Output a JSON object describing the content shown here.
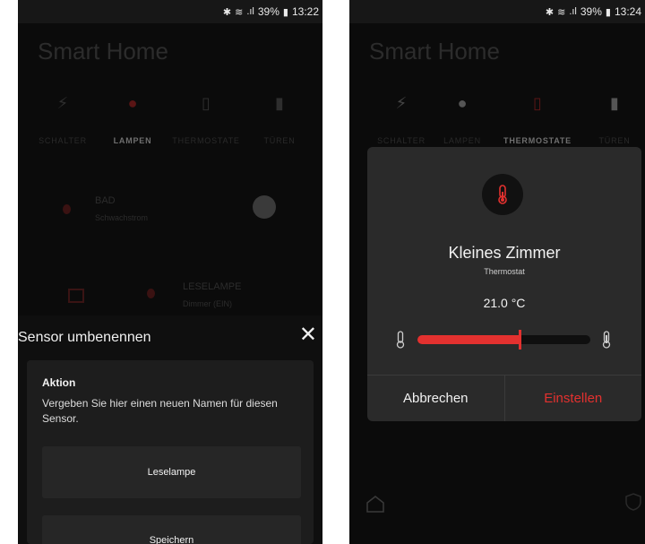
{
  "left": {
    "status": {
      "bluetooth": "✱",
      "wifi": "≋",
      "signal": ".ıl",
      "battery_pct": "39%",
      "battery": "▮",
      "time": "13:22"
    },
    "app_title": "Smart Home",
    "tabs": [
      {
        "label": "SCHALTER",
        "icon": "bolt-icon"
      },
      {
        "label": "LAMPEN",
        "icon": "bulb-icon"
      },
      {
        "label": "THERMOSTATE",
        "icon": "thermometer-icon"
      },
      {
        "label": "TÜREN",
        "icon": "door-icon"
      }
    ],
    "bg_items": [
      {
        "name": "BAD",
        "type": "Schwachstrom"
      },
      {
        "name": "LESELAMPE",
        "type": "Dimmer (EIN)"
      }
    ],
    "sheet": {
      "title": "Sensor umbenennen",
      "close": "✕",
      "heading": "Aktion",
      "description": "Vergeben Sie hier einen neuen Namen für diesen Sensor.",
      "input_value": "Leselampe",
      "save_label": "Speichern"
    }
  },
  "right": {
    "status": {
      "bluetooth": "✱",
      "wifi": "≋",
      "signal": ".ıl",
      "battery_pct": "39%",
      "battery": "▮",
      "time": "13:24"
    },
    "app_title": "Smart Home",
    "tabs": [
      {
        "label": "SCHALTER",
        "icon": "bolt-icon"
      },
      {
        "label": "LAMPEN",
        "icon": "bulb-icon"
      },
      {
        "label": "THERMOSTATE",
        "icon": "thermometer-icon"
      },
      {
        "label": "TÜREN",
        "icon": "door-icon"
      }
    ],
    "dialog": {
      "name": "Kleines Zimmer",
      "type": "Thermostat",
      "temperature": "21.0 °C",
      "slider_level": 0.59,
      "cancel_label": "Abbrechen",
      "confirm_label": "Einstellen"
    }
  },
  "colors": {
    "accent": "#e3312f",
    "background": "#0b0b0b",
    "dialog": "#2a2a2a"
  }
}
